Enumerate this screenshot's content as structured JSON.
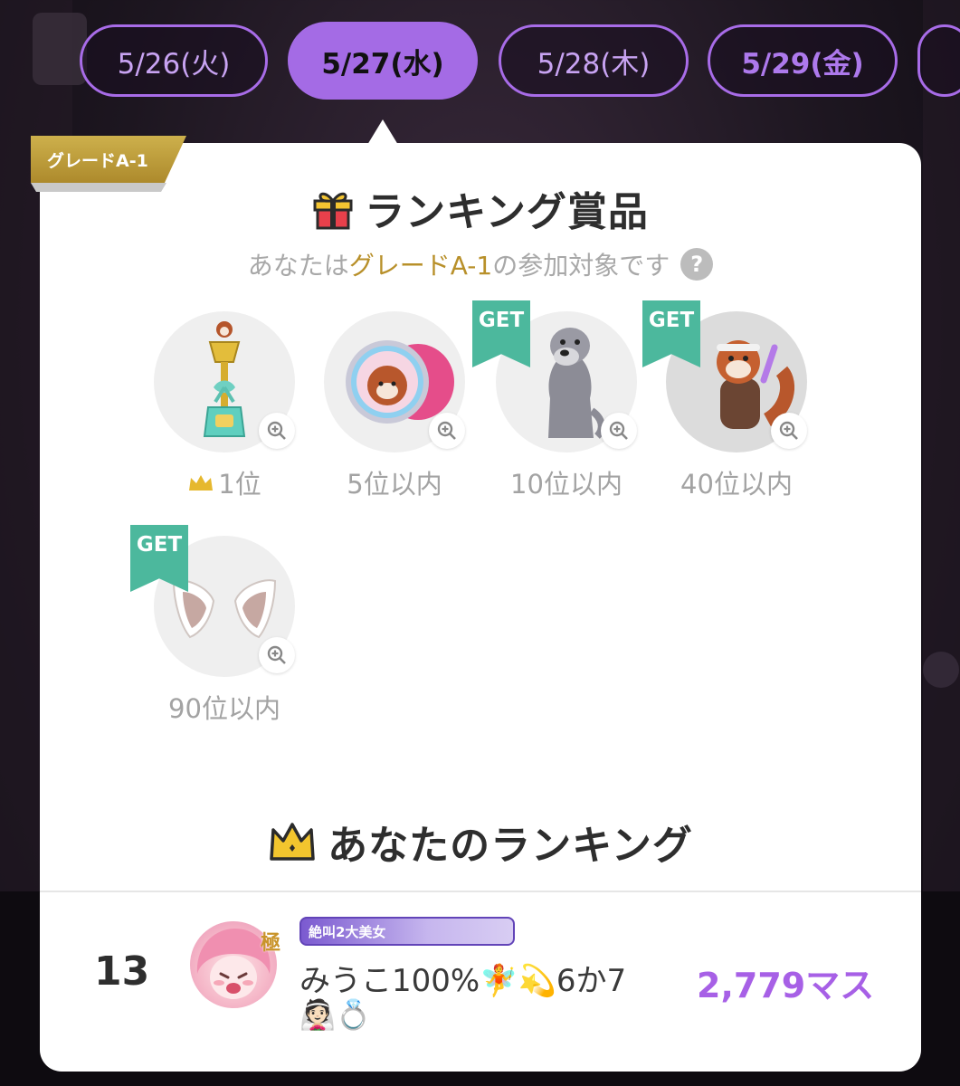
{
  "date_tabs": [
    {
      "label": "5/26(火)",
      "state": "inactive"
    },
    {
      "label": "5/27(水)",
      "state": "active"
    },
    {
      "label": "5/28(木)",
      "state": "inactive"
    },
    {
      "label": "5/29(金)",
      "state": "bold"
    }
  ],
  "grade_badge": "グレードA-1",
  "prizes_section": {
    "title": "ランキング賞品",
    "subtitle_prefix": "あなたは",
    "subtitle_grade": "グレードA-1",
    "subtitle_suffix": "の参加対象です",
    "help_symbol": "?",
    "get_label": "GET",
    "items": [
      {
        "rank": "1位",
        "icon": "trophy-icon",
        "got": false
      },
      {
        "rank": "5位以内",
        "icon": "red-panda-medal-icon",
        "got": false
      },
      {
        "rank": "10位以内",
        "icon": "schnauzer-dog-icon",
        "got": true
      },
      {
        "rank": "40位以内",
        "icon": "red-panda-costume-icon",
        "got": true
      },
      {
        "rank": "90位以内",
        "icon": "animal-ears-icon",
        "got": true
      }
    ]
  },
  "ranking_section": {
    "title": "あなたのランキング",
    "rank": "13",
    "avatar_badge": "極",
    "title_badge": "絶叫2大美女",
    "user_name": "みうこ100%🧚💫6か7",
    "user_name_line2": "👰🏻💍",
    "score": "2,779マス"
  },
  "colors": {
    "accent_purple": "#a46be5",
    "gold": "#b8902a",
    "get_green": "#4cb89d"
  }
}
